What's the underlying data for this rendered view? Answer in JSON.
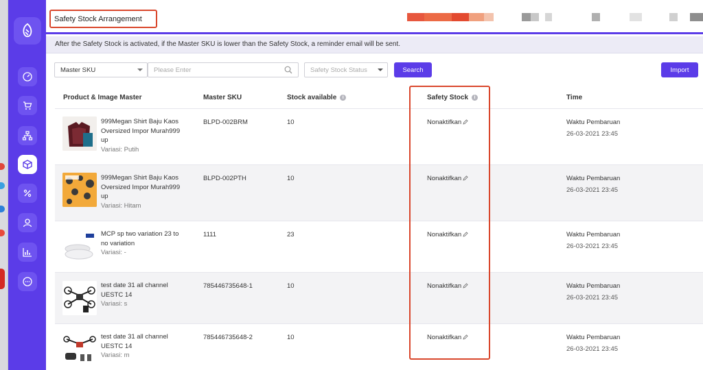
{
  "header": {
    "title": "Safety Stock Arrangement"
  },
  "notice": "After the Safety Stock is activated, if the Master SKU is lower than the Safety Stock, a reminder email will be sent.",
  "filter": {
    "type_select": "Master SKU",
    "search_placeholder": "Please Enter",
    "status_placeholder": "Safety Stock Status",
    "search_label": "Search",
    "import_label": "Import"
  },
  "table": {
    "columns": [
      "Product & Image Master",
      "Master SKU",
      "Stock available",
      "Safety Stock",
      "Time"
    ],
    "rows": [
      {
        "name": "999Megan Shirt Baju Kaos Oversized Impor Murah999 up",
        "variation": "Variasi: Putih",
        "sku": "BLPD-002BRM",
        "stock": "10",
        "safety": "Nonaktifkan",
        "time_label": "Waktu Pembaruan",
        "time": "26-03-2021 23:45"
      },
      {
        "name": "999Megan Shirt Baju Kaos Oversized Impor Murah999 up",
        "variation": "Variasi: Hitam",
        "sku": "BLPD-002PTH",
        "stock": "10",
        "safety": "Nonaktifkan",
        "time_label": "Waktu Pembaruan",
        "time": "26-03-2021 23:45"
      },
      {
        "name": "MCP sp two variation 23 to no variation",
        "variation": "Variasi: -",
        "sku": "1111",
        "stock": "23",
        "safety": "Nonaktifkan",
        "time_label": "Waktu Pembaruan",
        "time": "26-03-2021 23:45"
      },
      {
        "name": "test date 31 all channel UESTC 14",
        "variation": "Variasi: s",
        "sku": "785446735648-1",
        "stock": "10",
        "safety": "Nonaktifkan",
        "time_label": "Waktu Pembaruan",
        "time": "26-03-2021 23:45"
      },
      {
        "name": "test date 31 all channel UESTC 14",
        "variation": "Variasi: m",
        "sku": "785446735648-2",
        "stock": "10",
        "safety": "Nonaktifkan",
        "time_label": "Waktu Pembaruan",
        "time": "26-03-2021 23:45"
      }
    ]
  },
  "colors": {
    "brand": "#5b3ce8",
    "highlight": "#d9462b",
    "notice_bg": "#ecebf6"
  }
}
